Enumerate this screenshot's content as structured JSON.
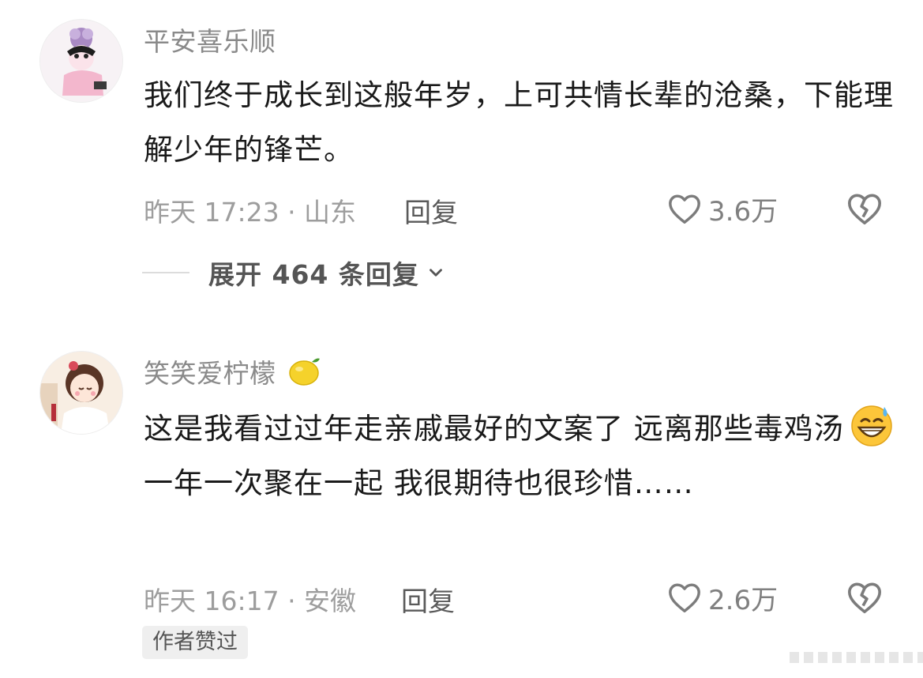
{
  "comments": [
    {
      "username": "平安喜乐顺",
      "content": "我们终于成长到这般年岁，上可共情长辈的沧桑，下能理解少年的锋芒。",
      "meta": "昨天 17:23 · 山东",
      "reply_label": "回复",
      "likes": "3.6万",
      "expand_label": "展开 464 条回复",
      "icons": [
        "avatar",
        "heart-icon",
        "broken-heart-icon",
        "chevron-down-icon"
      ]
    },
    {
      "username": "笑笑爱柠檬",
      "username_emoji": "lemon",
      "content_part1": "这是我看过过年走亲戚最好的文案了 远离那些毒鸡汤",
      "content_part2": " 一年一次聚在一起 我很期待也很珍惜……",
      "inline_emoji": "grinning-sweat-emoji",
      "meta": "昨天 16:17 · 安徽",
      "reply_label": "回复",
      "likes": "2.6万",
      "author_badge": "作者赞过",
      "icons": [
        "avatar",
        "lemon-icon",
        "heart-icon",
        "broken-heart-icon"
      ]
    }
  ]
}
